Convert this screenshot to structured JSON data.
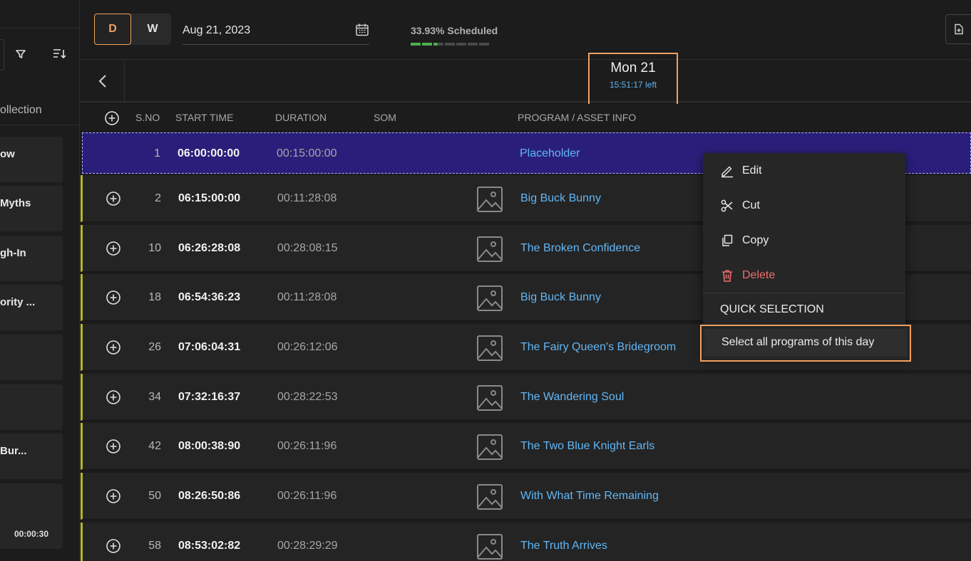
{
  "left_panel": {
    "collection_label": "ollection",
    "cards": [
      {
        "title": "ow",
        "duration": ""
      },
      {
        "title": "Myths",
        "duration": ""
      },
      {
        "title": "gh-In",
        "duration": ""
      },
      {
        "title": "ority ...",
        "duration": ""
      },
      {
        "title": "",
        "duration": ""
      },
      {
        "title": "",
        "duration": ""
      },
      {
        "title": "Bur...",
        "duration": ""
      },
      {
        "title": "",
        "duration": "00:00:30"
      }
    ]
  },
  "topbar": {
    "mode_day": "D",
    "mode_week": "W",
    "date_value": "Aug 21, 2023",
    "scheduled_text": "33.93% Scheduled",
    "scheduled_fraction": 0.3393
  },
  "dayhead": {
    "day_label": "Mon  21",
    "time_left": "15:51:17 left"
  },
  "columns": {
    "sno": "S.NO",
    "start_time": "START TIME",
    "duration": "DURATION",
    "som": "SOM",
    "program": "PROGRAM / ASSET INFO"
  },
  "rows": [
    {
      "sno": "1",
      "start": "06:00:00:00",
      "duration": "00:15:00:00",
      "program": "Placeholder"
    },
    {
      "sno": "2",
      "start": "06:15:00:00",
      "duration": "00:11:28:08",
      "program": "Big Buck Bunny"
    },
    {
      "sno": "10",
      "start": "06:26:28:08",
      "duration": "00:28:08:15",
      "program": "The Broken Confidence"
    },
    {
      "sno": "18",
      "start": "06:54:36:23",
      "duration": "00:11:28:08",
      "program": "Big Buck Bunny"
    },
    {
      "sno": "26",
      "start": "07:06:04:31",
      "duration": "00:26:12:06",
      "program": "The Fairy Queen's Bridegroom"
    },
    {
      "sno": "34",
      "start": "07:32:16:37",
      "duration": "00:28:22:53",
      "program": "The Wandering Soul"
    },
    {
      "sno": "42",
      "start": "08:00:38:90",
      "duration": "00:26:11:96",
      "program": "The Two Blue Knight Earls"
    },
    {
      "sno": "50",
      "start": "08:26:50:86",
      "duration": "00:26:11:96",
      "program": "With What Time Remaining"
    },
    {
      "sno": "58",
      "start": "08:53:02:82",
      "duration": "00:28:29:29",
      "program": "The Truth Arrives"
    }
  ],
  "context_menu": {
    "edit": "Edit",
    "cut": "Cut",
    "copy": "Copy",
    "delete": "Delete",
    "section_title": "QUICK SELECTION",
    "select_all": "Select all programs of this day"
  },
  "colors": {
    "accent_orange": "#f0a060",
    "link_blue": "#62b6f5",
    "selected_row": "#291f7a",
    "danger_red": "#ee6e6e",
    "row_marker": "#b6b52d"
  }
}
